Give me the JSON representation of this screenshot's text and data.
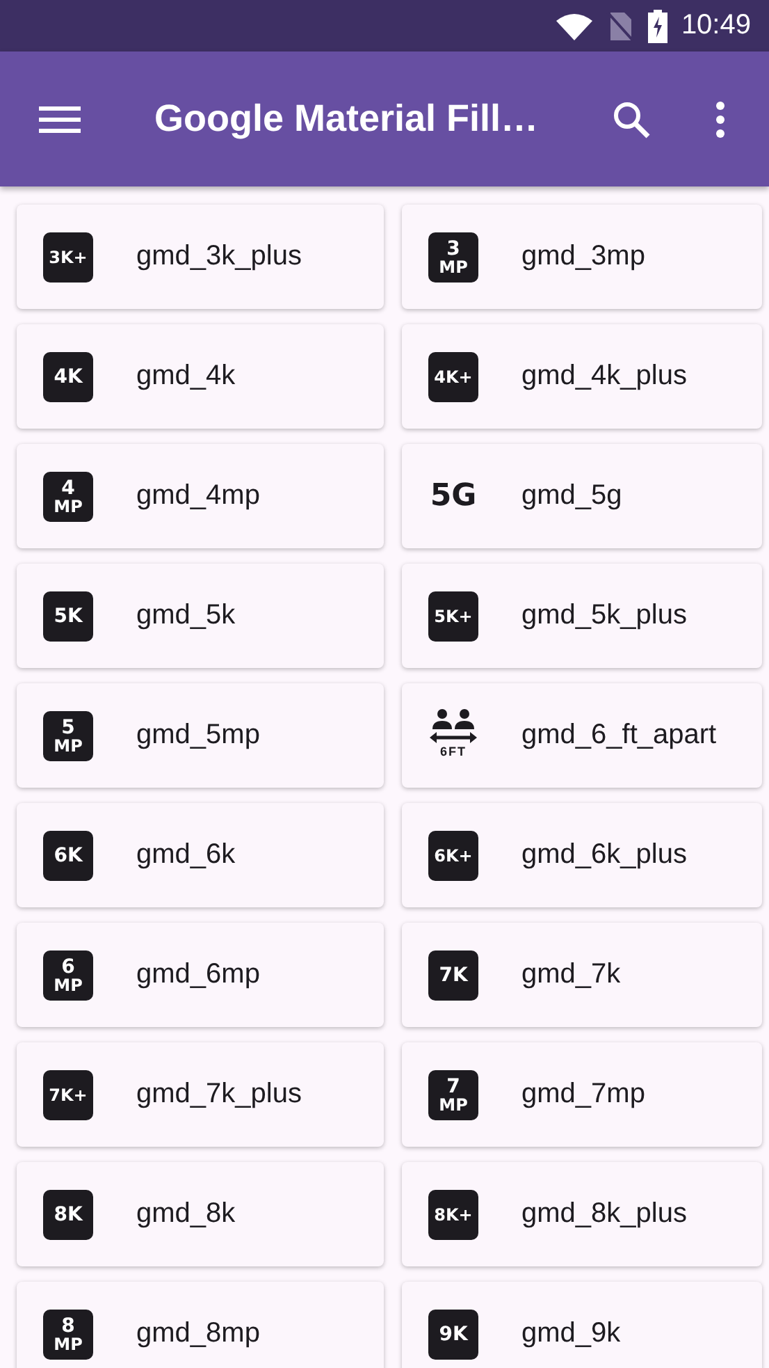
{
  "status_bar": {
    "time": "10:49"
  },
  "app_bar": {
    "title": "Google Material Fill…"
  },
  "items": [
    {
      "name": "gmd_3k_plus",
      "icon": {
        "kind": "badge",
        "glyph": "3K+"
      }
    },
    {
      "name": "gmd_3mp",
      "icon": {
        "kind": "mp",
        "glyph": "3",
        "sub": "MP"
      }
    },
    {
      "name": "gmd_4k",
      "icon": {
        "kind": "badge",
        "glyph": "4K"
      }
    },
    {
      "name": "gmd_4k_plus",
      "icon": {
        "kind": "badge",
        "glyph": "4K+"
      }
    },
    {
      "name": "gmd_4mp",
      "icon": {
        "kind": "mp",
        "glyph": "4",
        "sub": "MP"
      }
    },
    {
      "name": "gmd_5g",
      "icon": {
        "kind": "plain",
        "glyph": "5G"
      }
    },
    {
      "name": "gmd_5k",
      "icon": {
        "kind": "badge",
        "glyph": "5K"
      }
    },
    {
      "name": "gmd_5k_plus",
      "icon": {
        "kind": "badge",
        "glyph": "5K+"
      }
    },
    {
      "name": "gmd_5mp",
      "icon": {
        "kind": "mp",
        "glyph": "5",
        "sub": "MP"
      }
    },
    {
      "name": "gmd_6_ft_apart",
      "icon": {
        "kind": "apart",
        "glyph": "6FT"
      }
    },
    {
      "name": "gmd_6k",
      "icon": {
        "kind": "badge",
        "glyph": "6K"
      }
    },
    {
      "name": "gmd_6k_plus",
      "icon": {
        "kind": "badge",
        "glyph": "6K+"
      }
    },
    {
      "name": "gmd_6mp",
      "icon": {
        "kind": "mp",
        "glyph": "6",
        "sub": "MP"
      }
    },
    {
      "name": "gmd_7k",
      "icon": {
        "kind": "badge",
        "glyph": "7K"
      }
    },
    {
      "name": "gmd_7k_plus",
      "icon": {
        "kind": "badge",
        "glyph": "7K+"
      }
    },
    {
      "name": "gmd_7mp",
      "icon": {
        "kind": "mp",
        "glyph": "7",
        "sub": "MP"
      }
    },
    {
      "name": "gmd_8k",
      "icon": {
        "kind": "badge",
        "glyph": "8K"
      }
    },
    {
      "name": "gmd_8k_plus",
      "icon": {
        "kind": "badge",
        "glyph": "8K+"
      }
    },
    {
      "name": "gmd_8mp",
      "icon": {
        "kind": "mp",
        "glyph": "8",
        "sub": "MP"
      }
    },
    {
      "name": "gmd_9k",
      "icon": {
        "kind": "badge",
        "glyph": "9K"
      }
    }
  ]
}
